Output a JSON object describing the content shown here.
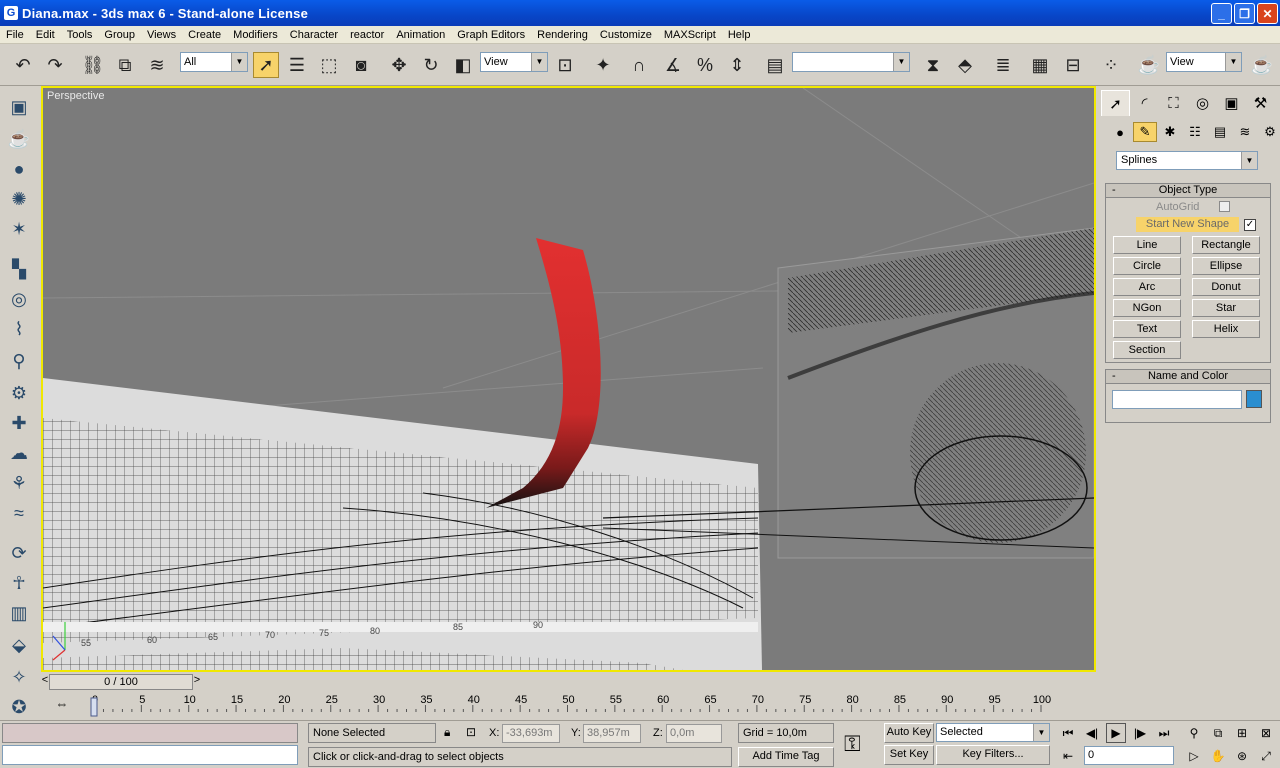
{
  "window": {
    "icon": "3ds-max-icon",
    "title": "Diana.max - 3ds max 6 - Stand-alone License",
    "minimize": "_",
    "maximize": "❐",
    "close": "✕"
  },
  "menu": [
    "File",
    "Edit",
    "Tools",
    "Group",
    "Views",
    "Create",
    "Modifiers",
    "Character",
    "reactor",
    "Animation",
    "Graph Editors",
    "Rendering",
    "Customize",
    "MAXScript",
    "Help"
  ],
  "toolbar": {
    "selection_filter": "All",
    "reference_coord": "View",
    "named_selection": "",
    "render_type": "View"
  },
  "viewport": {
    "label": "Perspective",
    "border_color": "#f0e800",
    "ruler_numbers": [
      "55",
      "60",
      "65",
      "70",
      "75",
      "80",
      "85",
      "90"
    ]
  },
  "command_panel": {
    "category": "Splines",
    "object_type": {
      "title": "Object Type",
      "collapse": "-",
      "autogrid": "AutoGrid",
      "start_new_shape": "Start New Shape",
      "start_new_shape_check": "✓",
      "buttons": [
        "Line",
        "Rectangle",
        "Circle",
        "Ellipse",
        "Arc",
        "Donut",
        "NGon",
        "Star",
        "Text",
        "Helix",
        "Section"
      ]
    },
    "name_color": {
      "title": "Name and Color",
      "collapse": "-",
      "name_value": "",
      "color": "#2a8ed0"
    }
  },
  "timeline": {
    "slider": "0 / 100",
    "ticks": [
      "0",
      "5",
      "10",
      "15",
      "20",
      "25",
      "30",
      "35",
      "40",
      "45",
      "50",
      "55",
      "60",
      "65",
      "70",
      "75",
      "80",
      "85",
      "90",
      "95",
      "100"
    ],
    "prev": "<",
    "next": ">"
  },
  "status": {
    "selection": "None Selected",
    "prompt": "Click or click-and-drag to select objects",
    "x_label": "X:",
    "x_value": "-33,693m",
    "y_label": "Y:",
    "y_value": "38,957m",
    "z_label": "Z:",
    "z_value": "0,0m",
    "grid": "Grid = 10,0m",
    "add_time_tag": "Add Time Tag",
    "auto_key": "Auto Key",
    "set_key": "Set Key",
    "key_mode": "Selected",
    "key_filters": "Key Filters...",
    "current_frame": "0"
  }
}
